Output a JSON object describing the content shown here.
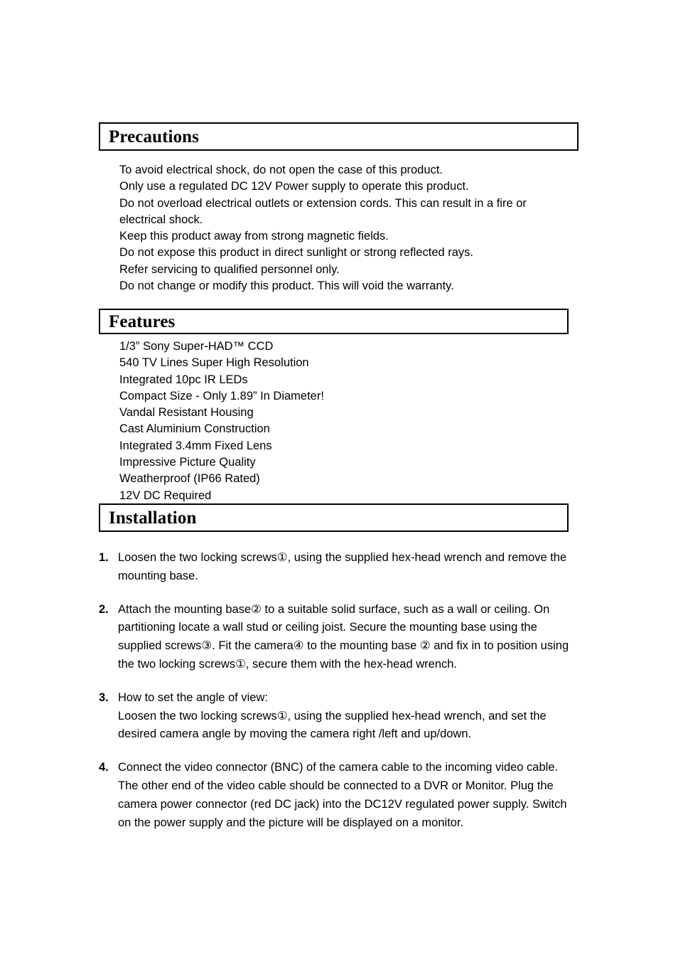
{
  "document": {
    "sections": [
      {
        "id": "precautions",
        "heading": "Precautions",
        "lines": [
          "To avoid electrical shock, do not open the case of this product.",
          "Only use a regulated DC 12V Power supply to operate this product.",
          "Do not overload electrical outlets or extension cords. This can result in a fire or electrical shock.",
          "Keep this product away from strong magnetic fields.",
          "Do not expose this product in direct sunlight or strong reflected rays.",
          "Refer servicing to qualified personnel only.",
          "Do not change or modify this product. This will void the warranty."
        ]
      },
      {
        "id": "features",
        "heading": "Features",
        "lines": [
          "1/3” Sony Super-HAD™ CCD",
          "540 TV Lines Super High Resolution",
          "Integrated 10pc IR LEDs",
          "Compact Size - Only 1.89” In Diameter!",
          "Vandal Resistant Housing",
          "Cast Aluminium Construction",
          "Integrated 3.4mm Fixed Lens",
          "Impressive Picture Quality",
          "Weatherproof (IP66 Rated)",
          "12V DC Required"
        ]
      },
      {
        "id": "installation",
        "heading": "Installation",
        "steps": [
          {
            "number": "1.",
            "text": "Loosen the two locking screws①, using the supplied hex-head wrench and remove the mounting base."
          },
          {
            "number": "2.",
            "text": "Attach the mounting base② to a suitable solid surface, such as a wall or ceiling. On partitioning locate a wall stud or ceiling joist. Secure the mounting base using the supplied screws③. Fit the camera④ to the mounting base ② and fix in to position using the two locking screws①, secure them with the hex-head wrench."
          },
          {
            "number": "3.",
            "line1": "How to set the angle of view:",
            "line2": "Loosen the two locking screws①, using the supplied hex-head wrench, and set the desired camera angle by moving the camera right /left and up/down."
          },
          {
            "number": "4.",
            "text": "Connect the video connector (BNC) of the camera cable to the incoming video cable.  The other end of the video cable should be connected to a DVR or Monitor. Plug the camera power connector (red DC jack) into the DC12V regulated power supply. Switch on the power supply and the picture will be displayed on a monitor."
          }
        ]
      }
    ]
  },
  "colors": {
    "text": "#000000",
    "background": "#ffffff",
    "border": "#000000"
  }
}
